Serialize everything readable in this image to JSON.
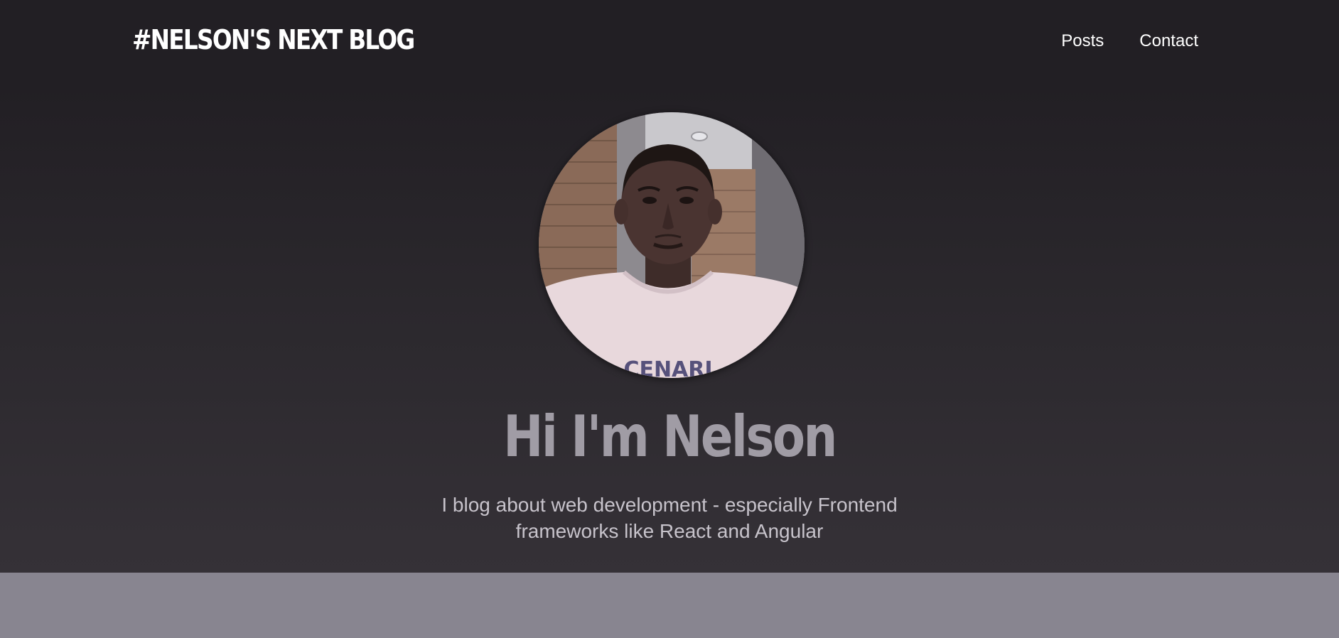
{
  "header": {
    "logo_text": "#NELSON'S NEXT BLOG",
    "nav": {
      "posts_label": "Posts",
      "contact_label": "Contact"
    }
  },
  "hero": {
    "avatar_alt": "Nelson",
    "title": "Hi I'm Nelson",
    "tagline": "I blog about web development - especially Frontend frameworks like React and Angular"
  },
  "colors": {
    "header_bg": "#221f24",
    "hero_bg_bottom": "#353137",
    "title_color": "#a09ca5",
    "tagline_color": "#c7c3cb",
    "content_bg": "#888590"
  }
}
